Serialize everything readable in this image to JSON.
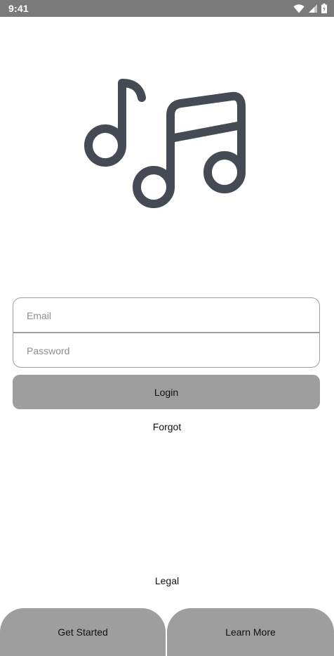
{
  "status_bar": {
    "time": "9:41",
    "icons": [
      "wifi-icon",
      "cell-signal-icon",
      "battery-icon"
    ]
  },
  "logo": {
    "icon": "music-notes-icon",
    "color": "#454a55"
  },
  "form": {
    "email_placeholder": "Email",
    "password_placeholder": "Password",
    "login_label": "Login",
    "forgot_label": "Forgot"
  },
  "footer": {
    "legal_label": "Legal",
    "get_started_label": "Get Started",
    "learn_more_label": "Learn More"
  },
  "colors": {
    "status_bar": "#7a7a7a",
    "button": "#9e9e9e",
    "border": "#9e9e9e",
    "background": "#ffffff",
    "icon": "#454a55"
  }
}
